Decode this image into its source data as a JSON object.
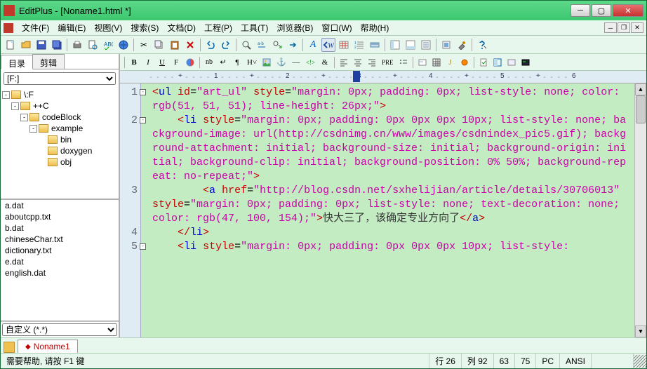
{
  "window": {
    "title": "EditPlus - [Noname1.html *]"
  },
  "menus": [
    "文件(F)",
    "编辑(E)",
    "视图(V)",
    "搜索(S)",
    "文档(D)",
    "工程(P)",
    "工具(T)",
    "浏览器(B)",
    "窗口(W)",
    "帮助(H)"
  ],
  "sidebar": {
    "tabs": [
      "目录",
      "剪辑"
    ],
    "drive": "[F:]",
    "tree": [
      {
        "indent": 0,
        "toggle": "-",
        "label": "\\:F"
      },
      {
        "indent": 1,
        "toggle": "-",
        "label": "++C"
      },
      {
        "indent": 2,
        "toggle": "-",
        "label": "codeBlock"
      },
      {
        "indent": 3,
        "toggle": "-",
        "label": "example"
      },
      {
        "indent": 4,
        "toggle": "",
        "label": "bin"
      },
      {
        "indent": 4,
        "toggle": "",
        "label": "doxygen"
      },
      {
        "indent": 4,
        "toggle": "",
        "label": "obj"
      }
    ],
    "files": [
      "a.dat",
      "aboutcpp.txt",
      "b.dat",
      "chineseChar.txt",
      "dictionary.txt",
      "e.dat",
      "english.dat"
    ],
    "filter": "自定义 (*.*)"
  },
  "ruler": {
    "marks": [
      "1",
      "2",
      "3",
      "4",
      "5",
      "6"
    ],
    "caret_col": 3
  },
  "code": {
    "lines": [
      {
        "n": "1",
        "fold": "-",
        "html": "<span class='t-bracket'>&lt;</span><span class='t-tag'>ul</span> <span class='t-attr'>id</span>=<span class='t-val'>\"art_ul\"</span> <span class='t-attr'>style</span>=<span class='t-val'>\"margin: 0px; padding: 0px; list-style: none; color: rgb(51, 51, 51); line-height: 26px;\"</span><span class='t-bracket'>&gt;</span>"
      },
      {
        "n": "2",
        "fold": "-",
        "html": "    <span class='t-bracket'>&lt;</span><span class='t-tag'>li</span> <span class='t-attr'>style</span>=<span class='t-val'>\"margin: 0px; padding: 0px 0px 0px 10px; list-style: none; background-image: url(http://csdnimg.cn/www/images/csdnindex_pic5.gif); background-attachment: initial; background-size: initial; background-origin: initial; background-clip: initial; background-position: 0% 50%; background-repeat: no-repeat;\"</span><span class='t-bracket'>&gt;</span>"
      },
      {
        "n": "3",
        "fold": "",
        "html": "        <span class='t-bracket'>&lt;</span><span class='t-tag'>a</span> <span class='t-attr'>href</span>=<span class='t-val'>\"http://blog.csdn.net/sxhelijian/article/details/30706013\"</span> <span class='t-attr'>style</span>=<span class='t-val'>\"margin: 0px; padding: 0px; list-style: none; text-decoration: none; color: rgb(47, 100, 154);\"</span><span class='t-bracket'>&gt;</span><span class='t-text'>快大三了，该确定专业方向了</span><span class='t-bracket'>&lt;/</span><span class='t-tag'>a</span><span class='t-bracket'>&gt;</span>"
      },
      {
        "n": "4",
        "fold": "",
        "html": "    <span class='t-bracket'>&lt;/</span><span class='t-tag'>li</span><span class='t-bracket'>&gt;</span>"
      },
      {
        "n": "5",
        "fold": "-",
        "html": "    <span class='t-bracket'>&lt;</span><span class='t-tag'>li</span> <span class='t-attr'>style</span>=<span class='t-val'>\"margin: 0px; padding: 0px 0px 0px 10px; list-style:</span>"
      }
    ]
  },
  "doc_tab": {
    "label": "Noname1"
  },
  "status": {
    "help": "需要帮助, 请按 F1 键",
    "line": "行 26",
    "col": "列 92",
    "c3": "63",
    "c4": "75",
    "c5": "PC",
    "c6": "ANSI"
  }
}
